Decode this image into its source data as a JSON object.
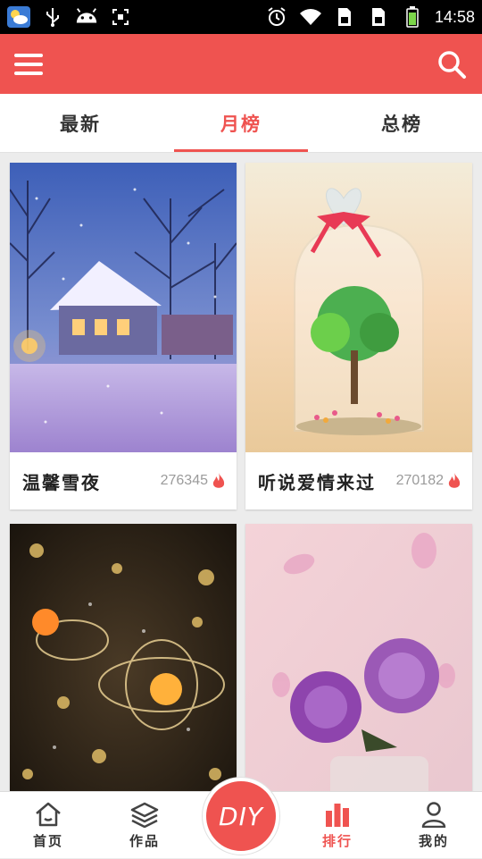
{
  "status_bar": {
    "time": "14:58",
    "left_icons": [
      "weather-icon",
      "usb-icon",
      "android-icon",
      "screenshot-icon"
    ],
    "right_icons": [
      "alarm-icon",
      "wifi-icon",
      "sim1-icon",
      "sim2-icon",
      "battery-icon"
    ]
  },
  "app_bar": {
    "menu_icon": "menu-icon",
    "search_icon": "search-icon",
    "accent_color": "#ef5350"
  },
  "tabs": [
    {
      "label": "最新",
      "active": false
    },
    {
      "label": "月榜",
      "active": true
    },
    {
      "label": "总榜",
      "active": false
    }
  ],
  "cards": [
    {
      "title": "温馨雪夜",
      "count": "276345",
      "icon": "flame-icon"
    },
    {
      "title": "听说爱情来过",
      "count": "270182",
      "icon": "flame-icon"
    },
    {
      "title": "",
      "count": ""
    },
    {
      "title": "",
      "count": ""
    }
  ],
  "bottom_nav": {
    "items": [
      {
        "label": "首页",
        "icon": "home-icon",
        "active": false
      },
      {
        "label": "作品",
        "icon": "layers-icon",
        "active": false
      },
      {
        "label": "排行",
        "icon": "ranking-icon",
        "active": true
      },
      {
        "label": "我的",
        "icon": "profile-icon",
        "active": false
      }
    ],
    "center_button": "DIY"
  }
}
